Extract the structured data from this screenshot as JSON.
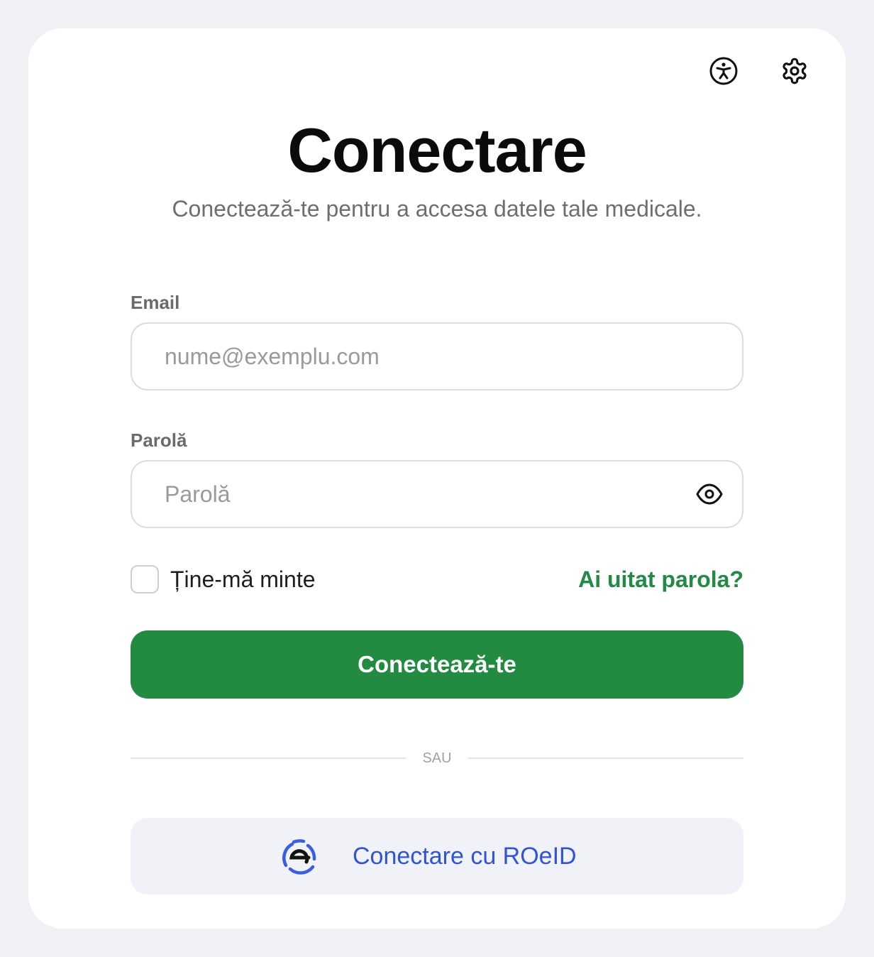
{
  "header": {
    "accessibility_icon": "accessibility-icon",
    "settings_icon": "gear-icon"
  },
  "title": "Conectare",
  "subtitle": "Conectează-te pentru a accesa datele tale medicale.",
  "email": {
    "label": "Email",
    "placeholder": "nume@exemplu.com",
    "value": ""
  },
  "password": {
    "label": "Parolă",
    "placeholder": "Parolă",
    "value": "",
    "toggle_icon": "eye-icon"
  },
  "remember": {
    "label": "Ține-mă minte",
    "checked": false
  },
  "forgot_link": "Ai uitat parola?",
  "submit_label": "Conectează-te",
  "divider_text": "SAU",
  "roeid": {
    "label": "Conectare cu ROeID",
    "logo_icon": "roeid-logo-icon"
  },
  "colors": {
    "primary": "#238a42",
    "link": "#228a44",
    "roeid_blue": "#2f55d4",
    "background": "#f1f1f5"
  }
}
